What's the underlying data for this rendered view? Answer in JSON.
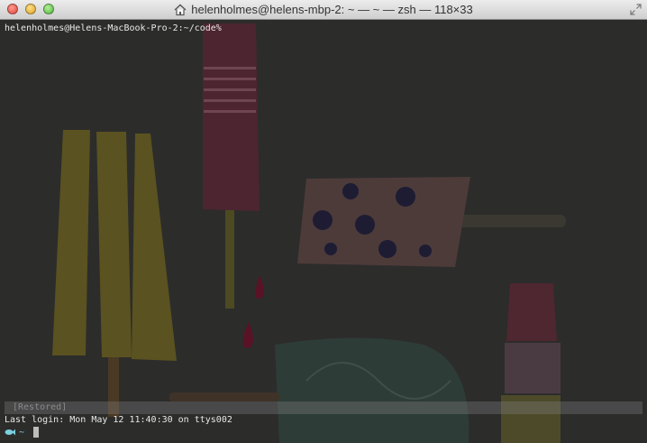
{
  "window": {
    "title": "helenholmes@helens-mbp-2: ~ — ~ — zsh — 118×33"
  },
  "terminal": {
    "prompt_line": "helenholmes@Helens-MacBook-Pro-2:~/code%",
    "restored_label": "[Restored]",
    "last_login": "Last login: Mon May 12 11:40:30 on ttys002",
    "prompt_dir": "~"
  },
  "colors": {
    "background": "#2b2b2a",
    "text": "#e8e8e8",
    "prompt_accent": "#7ad1e0",
    "close_light": "#e0443e",
    "minimize_light": "#dea123",
    "zoom_light": "#4fb53b"
  },
  "icons": {
    "title": "home-icon",
    "prompt": "fish-icon",
    "fullscreen": "fullscreen-arrows-icon"
  }
}
